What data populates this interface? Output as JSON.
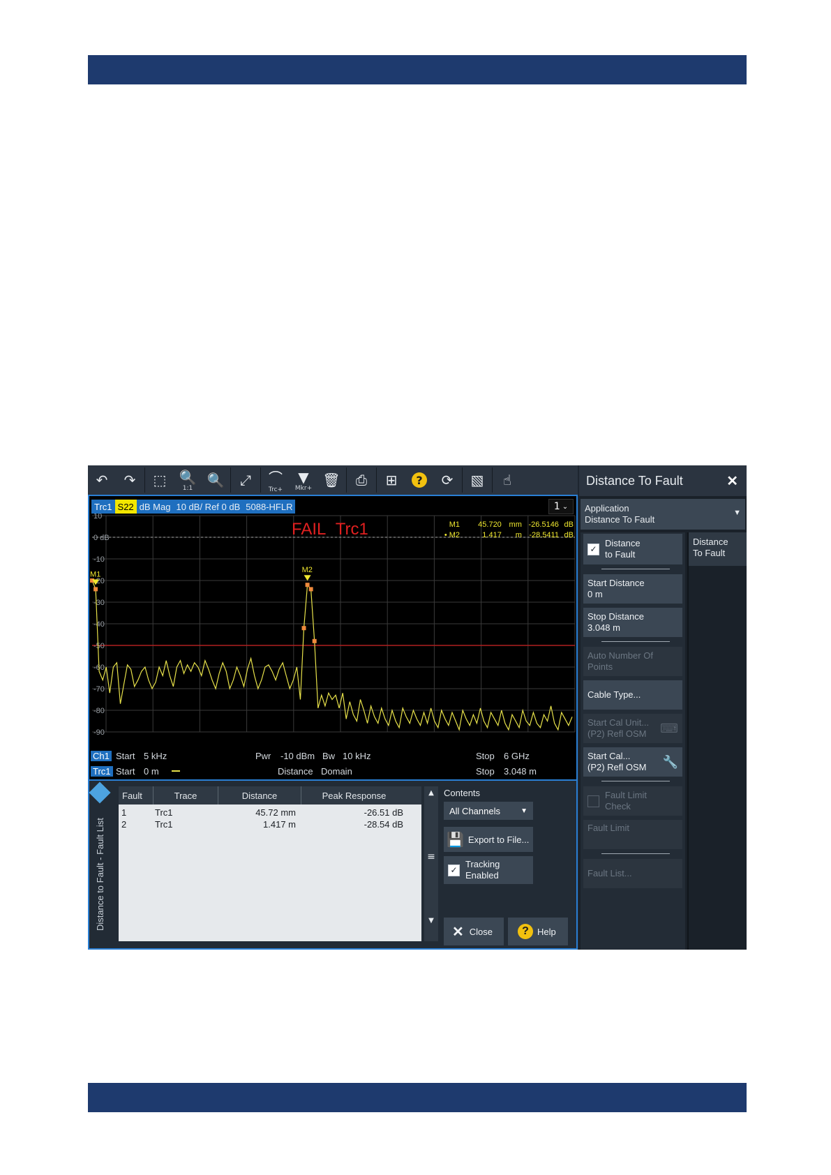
{
  "toolbar": {
    "items": [
      {
        "name": "undo-icon",
        "glyph": "↶",
        "sub": ""
      },
      {
        "name": "redo-icon",
        "glyph": "↷",
        "sub": ""
      },
      {
        "name": "zoom-select-icon",
        "glyph": "⬚",
        "sub": ""
      },
      {
        "name": "zoom-reset-icon",
        "glyph": "🔍",
        "sub": "1:1"
      },
      {
        "name": "zoom-settings-icon",
        "glyph": "🔍",
        "sub": ""
      },
      {
        "name": "fullscreen-icon",
        "glyph": "⤢",
        "sub": ""
      },
      {
        "name": "add-trace-icon",
        "glyph": "⌒",
        "sub": "Trc+"
      },
      {
        "name": "add-marker-icon",
        "glyph": "▼",
        "sub": "Mkr+"
      },
      {
        "name": "delete-icon",
        "glyph": "🗑",
        "sub": ""
      },
      {
        "name": "print-icon",
        "glyph": "⎙",
        "sub": ""
      },
      {
        "name": "windows-icon",
        "glyph": "⊞",
        "sub": ""
      },
      {
        "name": "help-icon",
        "glyph": "?",
        "sub": ""
      },
      {
        "name": "refresh-icon",
        "glyph": "⟳",
        "sub": ""
      },
      {
        "name": "display-icon",
        "glyph": "▧",
        "sub": ""
      },
      {
        "name": "touch-icon",
        "glyph": "☝",
        "sub": ""
      }
    ]
  },
  "trace_bar": {
    "trace": "Trc1",
    "param": "S22",
    "format": "dB Mag",
    "scale": "10 dB/ Ref 0 dB",
    "calkit": "5088-HFLR"
  },
  "channel_selector": "1",
  "fail_label": {
    "fail": "FAIL",
    "trace": "Trc1"
  },
  "markers": [
    {
      "name": "M1",
      "prefix": "",
      "x": "45.720",
      "xunit": "mm",
      "y": "-26.5146",
      "yunit": "dB"
    },
    {
      "name": "M2",
      "prefix": "•",
      "x": "1.417",
      "xunit": "m",
      "y": "-28.5411",
      "yunit": "dB"
    }
  ],
  "chart_data": {
    "type": "line",
    "ylim": [
      -90,
      10
    ],
    "xlim": [
      0,
      3.048
    ],
    "yticks": [
      "10",
      "0 dB",
      "-10",
      "-20",
      "-30",
      "-40",
      "-50",
      "-60",
      "-70",
      "-80",
      "-90"
    ],
    "limit_line": -50,
    "grid": true,
    "marker_labels": [
      "M1",
      "M2"
    ],
    "series": [
      {
        "values": [
          -20,
          -24,
          -62,
          -66,
          -60,
          -72,
          -60,
          -58,
          -77,
          -68,
          -59,
          -61,
          -69,
          -66,
          -62,
          -60,
          -66,
          -70,
          -67,
          -60,
          -64,
          -57,
          -64,
          -69,
          -60,
          -57,
          -63,
          -59,
          -62,
          -58,
          -60,
          -64,
          -57,
          -61,
          -66,
          -70,
          -63,
          -58,
          -62,
          -70,
          -66,
          -60,
          -64,
          -69,
          -61,
          -56,
          -64,
          -70,
          -66,
          -60,
          -59,
          -62,
          -66,
          -61,
          -58,
          -64,
          -70,
          -66,
          -60,
          -75,
          -42,
          -22,
          -24,
          -48,
          -79,
          -73,
          -78,
          -72,
          -75,
          -73,
          -79,
          -72,
          -84,
          -76,
          -82,
          -85,
          -75,
          -80,
          -86,
          -78,
          -83,
          -86,
          -79,
          -84,
          -87,
          -80,
          -85,
          -88,
          -79,
          -83,
          -86,
          -80,
          -84,
          -87,
          -81,
          -86,
          -79,
          -85,
          -88,
          -80,
          -84,
          -87,
          -81,
          -85,
          -89,
          -80,
          -84,
          -87,
          -82,
          -86,
          -79,
          -85,
          -88,
          -81,
          -84,
          -87,
          -80,
          -86,
          -89,
          -82,
          -85,
          -88,
          -80,
          -85,
          -87,
          -81,
          -86,
          -88,
          -82,
          -85,
          -78,
          -86,
          -89,
          -81,
          -84,
          -87,
          -83
        ]
      }
    ]
  },
  "channel_info": {
    "ch_tag": "Ch1",
    "start_label": "Start",
    "start_value": "5 kHz",
    "pwr_label": "Pwr",
    "pwr_value": "-10 dBm",
    "bw_label": "Bw",
    "bw_value": "10 kHz",
    "stop_label": "Stop",
    "stop_value": "6 GHz",
    "trc_tag": "Trc1",
    "trc_start_label": "Start",
    "trc_start_value": "0 m",
    "distance_label": "Distance",
    "domain_label": "Domain",
    "trc_stop_label": "Stop",
    "trc_stop_value": "3.048 m"
  },
  "fault_panel": {
    "title": "Distance to Fault - Fault List",
    "columns": [
      "Fault",
      "Trace",
      "Distance",
      "Peak Response"
    ],
    "rows": [
      {
        "fault": "1",
        "trace": "Trc1",
        "distance": "45.72 mm",
        "peak": "-26.51 dB"
      },
      {
        "fault": "2",
        "trace": "Trc1",
        "distance": "1.417 m",
        "peak": "-28.54 dB"
      }
    ],
    "contents_label": "Contents",
    "contents_value": "All Channels",
    "export_label": "Export to File...",
    "tracking_label1": "Tracking",
    "tracking_label2": "Enabled",
    "close_label": "Close",
    "help_label": "Help"
  },
  "softtool": {
    "title": "Distance To Fault",
    "app_line1": "Application",
    "app_line2": "Distance To Fault",
    "tab_line1": "Distance",
    "tab_line2": "To Fault",
    "dtf_line1": "Distance",
    "dtf_line2": "to Fault",
    "start_dist_label": "Start Distance",
    "start_dist_value": "0 m",
    "stop_dist_label": "Stop Distance",
    "stop_dist_value": "3.048 m",
    "auto_points_line1": "Auto Number Of",
    "auto_points_line2": "Points",
    "cable_type": "Cable Type...",
    "start_cal_unit_line1": "Start Cal Unit...",
    "start_cal_unit_line2": "(P2) Refl OSM",
    "start_cal_line1": "Start Cal...",
    "start_cal_line2": "(P2) Refl OSM",
    "fault_limit_check_line1": "Fault Limit",
    "fault_limit_check_line2": "Check",
    "fault_limit": "Fault Limit",
    "fault_list": "Fault List..."
  },
  "colors": {
    "trace": "#e8e24a",
    "marker": "#f08a3c",
    "limit": "#b02020",
    "accent": "#2a7fd4"
  }
}
